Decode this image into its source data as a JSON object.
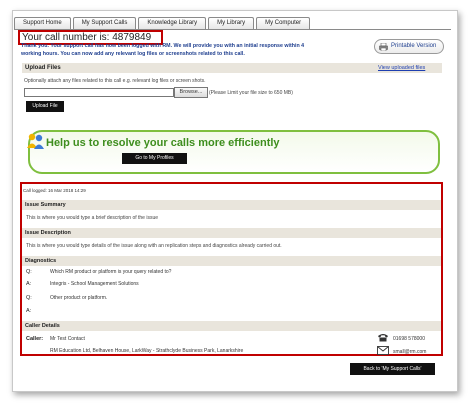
{
  "tabs": [
    "Support Home",
    "My Support Calls",
    "Knowledge Library",
    "My Library",
    "My Computer"
  ],
  "call_number": "Your call number is: 4879849",
  "thanks": {
    "line1": "Thank you. Your support call has now been logged with RM. We will provide you with an initial response within 4",
    "line2": "working hours. You can now add any relevant log files or screenshots related to this call."
  },
  "printable_label": "Printable Version",
  "upload": {
    "heading": "Upload Files",
    "view_link": "View uploaded files",
    "attach_text": "Optionally attach any files related to this call e.g. relevant log files or screen shots.",
    "browse_label": "Browse...",
    "limit_text": "(Please Limit your file size to 650 MB)",
    "upload_button": "Upload File"
  },
  "help": {
    "title": "Help us to resolve your calls more efficiently",
    "button": "Go to My Profiles",
    "accent": "#3e8e1e"
  },
  "details": {
    "logged": "Call logged: 16 Mar 2018 14:29",
    "issue_summary": {
      "heading": "Issue Summary",
      "text": "This is where you would type a brief description of the issue"
    },
    "issue_description": {
      "heading": "Issue Description",
      "text": "This is where you would type details of the issue along with an replication steps and diagnostics already carried out."
    },
    "diagnostics": {
      "heading": "Diagnostics",
      "rows": [
        {
          "label": "Q:",
          "text": "Which RM product or platform is your query related to?"
        },
        {
          "label": "A:",
          "text": "Integris - School Management Solutions"
        },
        {
          "label": "Q:",
          "text": "Other product or platform."
        },
        {
          "label": "A:",
          "text": ""
        }
      ]
    },
    "caller": {
      "heading": "Caller Details",
      "label": "Caller:",
      "name": "Mr Test Contact",
      "address": "RM Education Ltd, Belhaven House, LarkWay - Strathclyde Business Park, Lanarkshire",
      "phone": "01698 578000",
      "email": "small@rm.com"
    }
  },
  "back_button": "Back to 'My Support Calls'",
  "colors": {
    "highlight": "#c00000",
    "link": "#1f3fb0",
    "section": "#e9e5dc"
  }
}
